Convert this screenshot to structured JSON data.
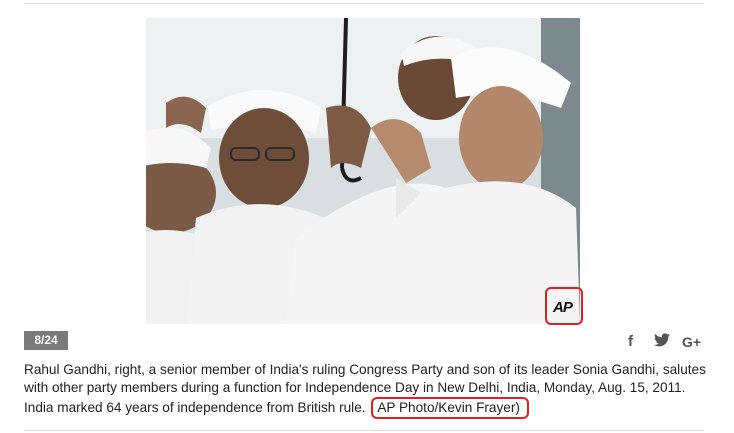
{
  "gallery": {
    "counter": "8/24",
    "share": {
      "facebook": "f",
      "twitter": "twitter-bird-icon",
      "googleplus": "G+"
    },
    "photo": {
      "watermark": "AP"
    },
    "caption": {
      "text": "Rahul Gandhi, right, a senior member of India's ruling Congress Party and son of its leader Sonia Gandhi, salutes with other party members during a function for Independence Day in New Delhi, India, Monday, Aug. 15, 2011. India marked 64 years of independence from British rule.",
      "credit": "AP Photo/Kevin Frayer)"
    },
    "colors": {
      "highlight": "#e02020",
      "counter_bg": "#7a7a7a"
    }
  }
}
